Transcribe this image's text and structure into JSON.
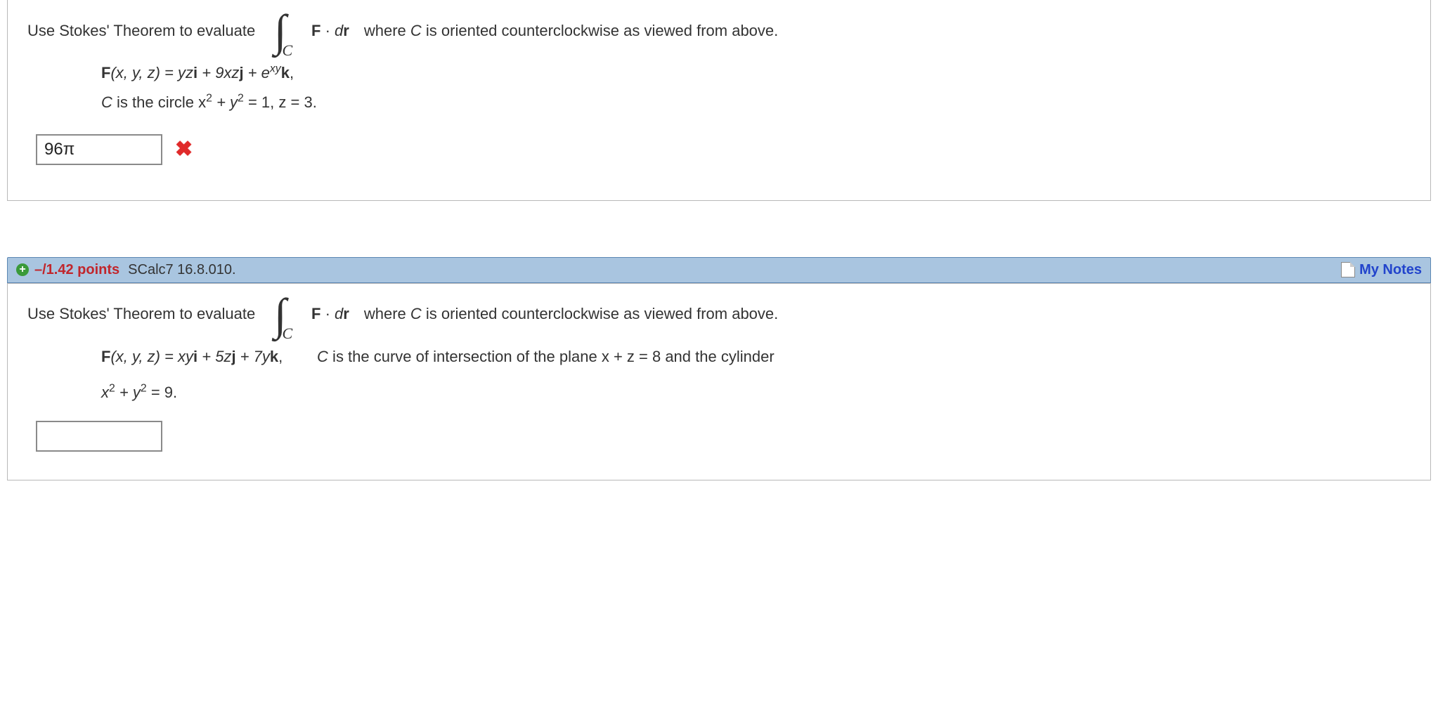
{
  "q1": {
    "prompt_pre": "Use Stokes' Theorem to evaluate",
    "integral_sub": "C",
    "integrand_F": "F",
    "integrand_dot": " · ",
    "integrand_d": "d",
    "integrand_r": "r",
    "prompt_post_1": "  where ",
    "prompt_post_C": "C",
    "prompt_post_2": " is oriented counterclockwise as viewed from above.",
    "line1_Fpre": "F",
    "line1_args": "(x, y, z) = yz",
    "line1_i": "i",
    "line1_mid1": " + 9xz",
    "line1_j": "j",
    "line1_mid2": " + e",
    "line1_exp": "xy",
    "line1_k": "k",
    "line1_end": ",",
    "line2_C": "C",
    "line2_text": " is the circle  x",
    "line2_sq1": "2",
    "line2_plus": " + y",
    "line2_sq2": "2",
    "line2_eq": " = 1, z = 3.",
    "answer_value": "96π",
    "answer_correct": false
  },
  "header": {
    "points": "–/1.42 points",
    "source": "SCalc7 16.8.010.",
    "notes": "My Notes"
  },
  "q2": {
    "prompt_pre": "Use Stokes' Theorem to evaluate",
    "integral_sub": "C",
    "integrand_F": "F",
    "integrand_dot": " · ",
    "integrand_d": "d",
    "integrand_r": "r",
    "prompt_post_1": "  where ",
    "prompt_post_C": "C",
    "prompt_post_2": " is oriented counterclockwise as viewed from above.",
    "line1_Fpre": "F",
    "line1_args": "(x, y, z) = xy",
    "line1_i": "i",
    "line1_mid1": " + 5z",
    "line1_j": "j",
    "line1_mid2": " + 7y",
    "line1_k": "k",
    "line1_end": ",",
    "cond_C": "C",
    "cond_text": " is the curve of intersection of the plane  x + z = 8  and the cylinder",
    "line2_x": "x",
    "line2_sq1": "2",
    "line2_plus": " + y",
    "line2_sq2": "2",
    "line2_eq": " = 9.",
    "answer_value": ""
  }
}
